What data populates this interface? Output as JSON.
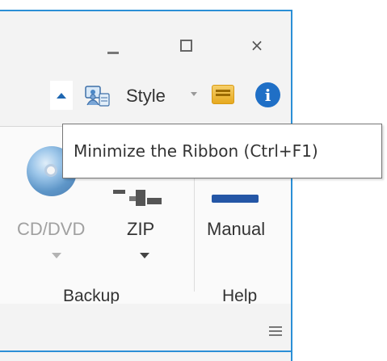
{
  "window": {
    "caption": {
      "minimize": "minimize",
      "maximize": "maximize",
      "close": "×"
    }
  },
  "quickbar": {
    "style_label": "Style",
    "info_glyph": "i"
  },
  "tooltip": {
    "text": "Minimize the Ribbon (Ctrl+F1)"
  },
  "ribbon": {
    "groups": [
      {
        "label": "Backup",
        "buttons": [
          {
            "label": "CD/DVD",
            "enabled": false
          },
          {
            "label": "ZIP",
            "enabled": true
          }
        ]
      },
      {
        "label": "Help",
        "buttons": [
          {
            "label": "Manual",
            "enabled": true
          }
        ]
      }
    ]
  },
  "colors": {
    "accent": "#2b8fd6",
    "info_icon": "#1f6fc6",
    "disabled_text": "#a0a0a0"
  },
  "icons": {
    "collapse": "chevron-up-icon",
    "style": "style-icon",
    "theme": "theme-icon",
    "info": "info-icon",
    "cd": "cd-dvd-icon",
    "zip": "zip-icon",
    "manual": "manual-icon",
    "menu": "hamburger-icon"
  }
}
